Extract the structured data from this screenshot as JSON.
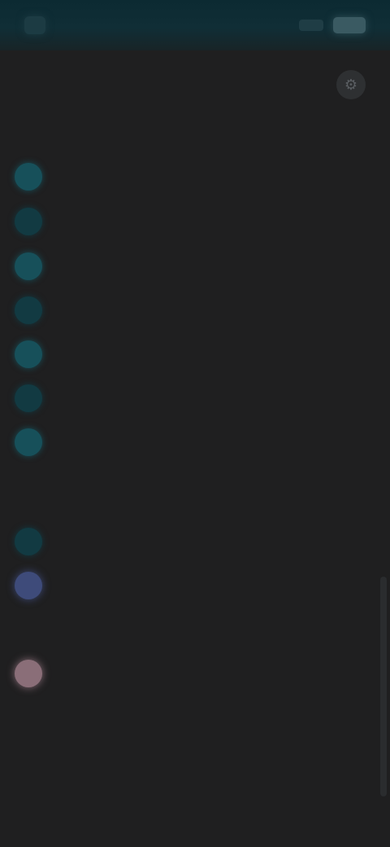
{
  "status_bar": {
    "time": "",
    "app_icon": "app-icon",
    "battery_icon": "battery-icon",
    "signal_icon": "signal-icon"
  },
  "top_action": {
    "icon": "settings-icon",
    "glyph": "⚙"
  },
  "sections": [
    {
      "header": "",
      "items": [
        {
          "label": "",
          "icon": "teal"
        },
        {
          "label": "",
          "icon": "teal"
        },
        {
          "label": "",
          "icon": "teal"
        },
        {
          "label": "",
          "icon": "teal"
        },
        {
          "label": "",
          "icon": "teal"
        },
        {
          "label": "",
          "icon": "teal"
        },
        {
          "label": "",
          "icon": "teal"
        }
      ]
    },
    {
      "header": "",
      "items": [
        {
          "label": "",
          "icon": "teal"
        },
        {
          "label": "",
          "icon": "blue"
        },
        {
          "label": "",
          "icon": "pink"
        }
      ]
    }
  ],
  "footer": {
    "note": "",
    "link": ""
  },
  "colors": {
    "background": "#1f1f20",
    "status_bar": "#0c2a32",
    "accent_teal": "#17505a",
    "accent_blue": "#3e4b7a",
    "accent_pink": "#8a6e78"
  }
}
